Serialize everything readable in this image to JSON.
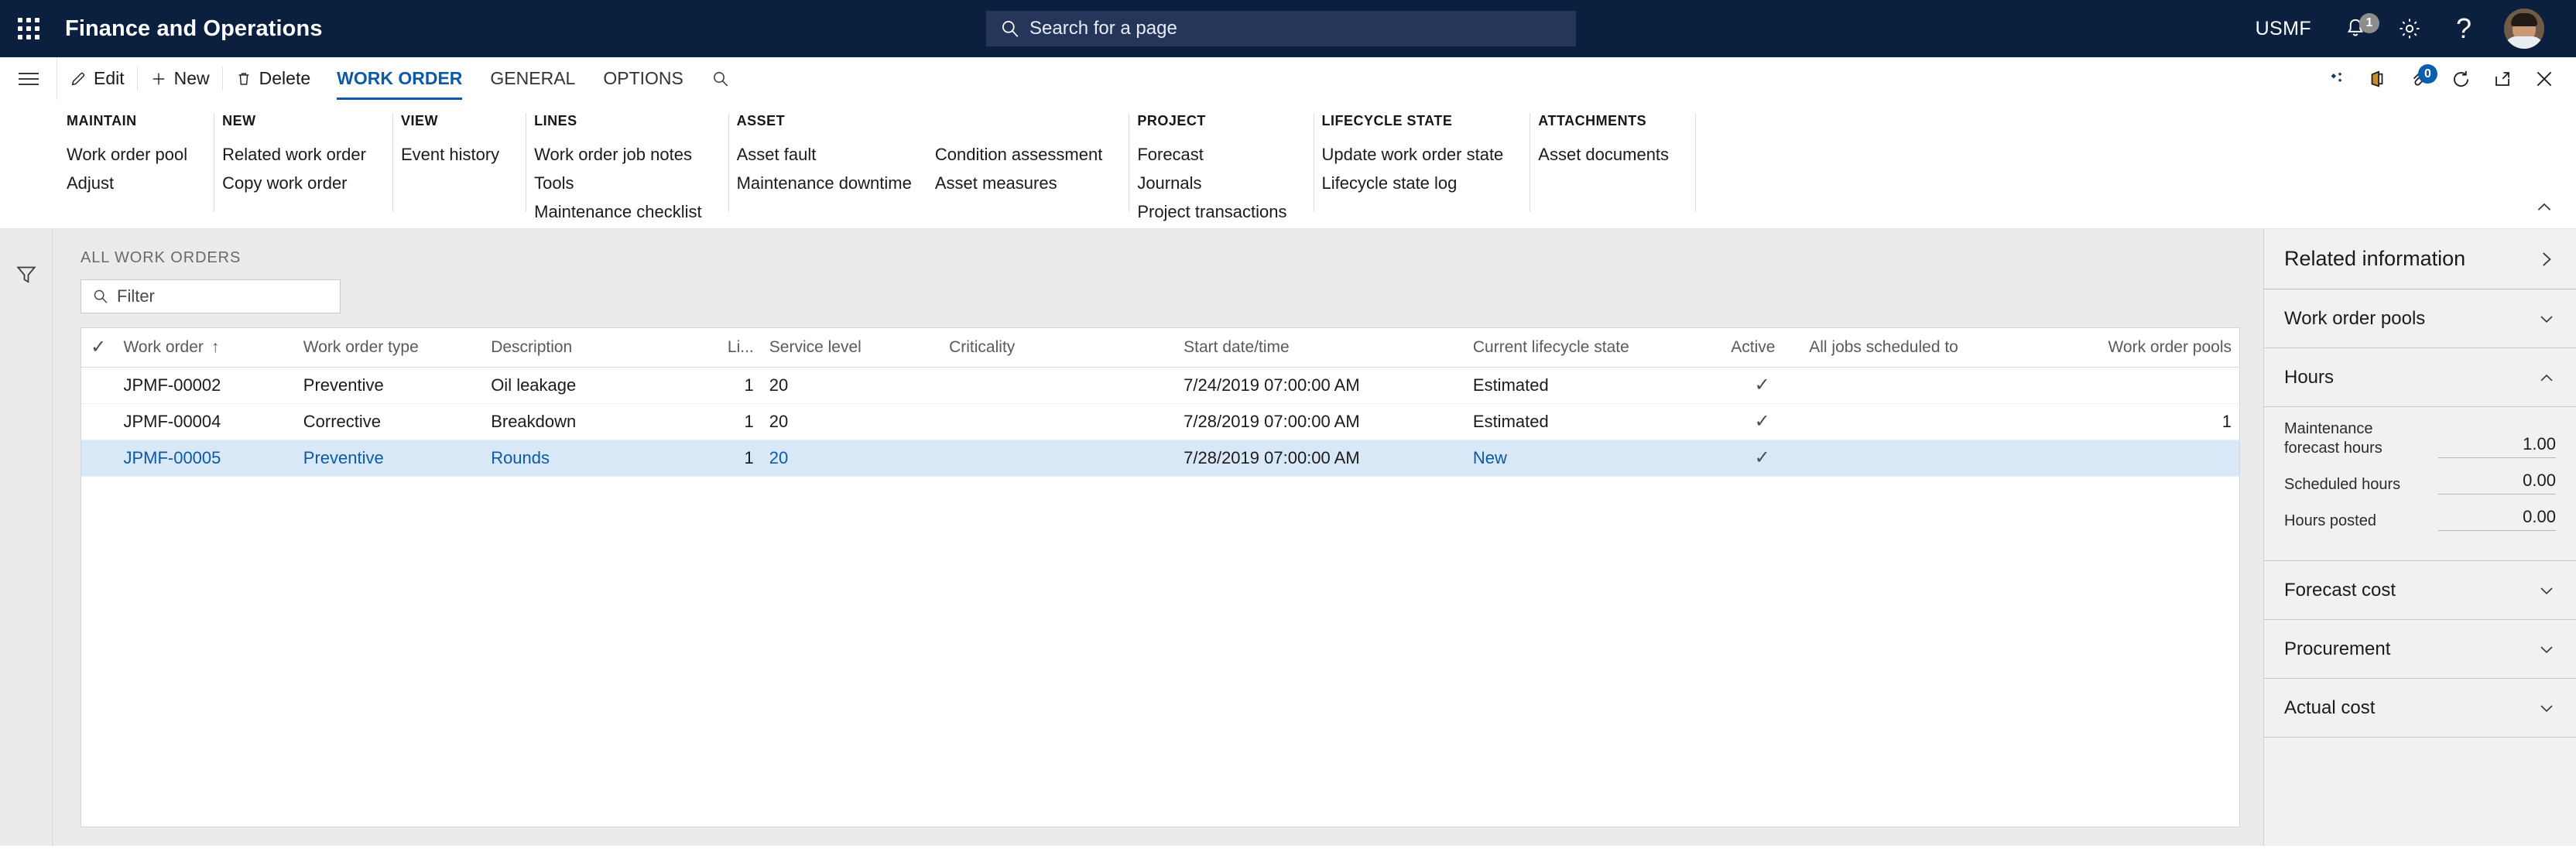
{
  "header": {
    "app_title": "Finance and Operations",
    "waffle_icon": "app-launcher-icon",
    "search_placeholder": "Search for a page",
    "search_icon": "search-icon",
    "company": "USMF",
    "notification_icon": "bell-icon",
    "notification_count": "1",
    "settings_icon": "gear-icon",
    "help_icon": "question-mark-icon",
    "avatar_icon": "user-avatar"
  },
  "action_pane": {
    "menu_icon": "hamburger-icon",
    "buttons": [
      {
        "label": "Edit",
        "icon": "pencil-icon"
      },
      {
        "label": "New",
        "icon": "plus-icon"
      },
      {
        "label": "Delete",
        "icon": "trash-icon"
      }
    ],
    "tabs": [
      {
        "label": "WORK ORDER",
        "active": true
      },
      {
        "label": "GENERAL",
        "active": false
      },
      {
        "label": "OPTIONS",
        "active": false
      }
    ],
    "tab_search_icon": "search-icon",
    "right_icons": [
      {
        "name": "personalize-icon"
      },
      {
        "name": "office-icon"
      },
      {
        "name": "attachment-icon",
        "badge": "0"
      },
      {
        "name": "refresh-icon"
      },
      {
        "name": "open-in-new-window-icon"
      },
      {
        "name": "close-icon"
      }
    ],
    "collapse_icon": "chevron-up-icon"
  },
  "ribbon": {
    "groups": [
      {
        "title": "MAINTAIN",
        "columns": [
          [
            "Work order pool",
            "Adjust"
          ]
        ]
      },
      {
        "title": "NEW",
        "columns": [
          [
            "Related work order",
            "Copy work order"
          ]
        ]
      },
      {
        "title": "VIEW",
        "columns": [
          [
            "Event history"
          ]
        ]
      },
      {
        "title": "LINES",
        "columns": [
          [
            "Work order job notes",
            "Tools",
            "Maintenance checklist"
          ]
        ]
      },
      {
        "title": "ASSET",
        "columns": [
          [
            "Asset fault",
            "Maintenance downtime"
          ],
          [
            "Condition assessment",
            "Asset measures"
          ]
        ]
      },
      {
        "title": "PROJECT",
        "columns": [
          [
            "Forecast",
            "Journals",
            "Project transactions"
          ]
        ]
      },
      {
        "title": "LIFECYCLE STATE",
        "columns": [
          [
            "Update work order state",
            "Lifecycle state log"
          ]
        ]
      },
      {
        "title": "ATTACHMENTS",
        "columns": [
          [
            "Asset documents"
          ]
        ]
      }
    ]
  },
  "left_rail": {
    "filter_icon": "funnel-icon"
  },
  "grid": {
    "caption": "ALL WORK ORDERS",
    "filter_placeholder": "Filter",
    "filter_icon": "search-icon",
    "select_all_icon": "checkmark-icon",
    "sort_indicator": "↑",
    "columns": [
      "Work order",
      "Work order type",
      "Description",
      "Li...",
      "Service level",
      "Criticality",
      "Start date/time",
      "Current lifecycle state",
      "Active",
      "All jobs scheduled to",
      "Work order pools"
    ],
    "sorted_column": "Work order",
    "rows": [
      {
        "work_order": "JPMF-00002",
        "type": "Preventive",
        "description": "Oil leakage",
        "lines": "1",
        "service_level": "20",
        "criticality": "",
        "start_datetime": "7/24/2019 07:00:00 AM",
        "lifecycle_state": "Estimated",
        "active": "✓",
        "all_jobs_scheduled_to": "",
        "work_order_pools": "",
        "selected": false
      },
      {
        "work_order": "JPMF-00004",
        "type": "Corrective",
        "description": "Breakdown",
        "lines": "1",
        "service_level": "20",
        "criticality": "",
        "start_datetime": "7/28/2019 07:00:00 AM",
        "lifecycle_state": "Estimated",
        "active": "✓",
        "all_jobs_scheduled_to": "",
        "work_order_pools": "1",
        "selected": false
      },
      {
        "work_order": "JPMF-00005",
        "type": "Preventive",
        "description": "Rounds",
        "lines": "1",
        "service_level": "20",
        "criticality": "",
        "start_datetime": "7/28/2019 07:00:00 AM",
        "lifecycle_state": "New",
        "active": "✓",
        "all_jobs_scheduled_to": "",
        "work_order_pools": "",
        "selected": true
      }
    ]
  },
  "right_panel": {
    "title": "Related information",
    "title_icon": "chevron-right-icon",
    "sections": [
      {
        "title": "Work order pools",
        "expanded": false,
        "icon": "chevron-down-icon"
      },
      {
        "title": "Hours",
        "expanded": true,
        "icon": "chevron-up-icon"
      },
      {
        "title": "Forecast cost",
        "expanded": false,
        "icon": "chevron-down-icon"
      },
      {
        "title": "Procurement",
        "expanded": false,
        "icon": "chevron-down-icon"
      },
      {
        "title": "Actual cost",
        "expanded": false,
        "icon": "chevron-down-icon"
      }
    ],
    "hours_fields": [
      {
        "label": "Maintenance forecast hours",
        "value": "1.00"
      },
      {
        "label": "Scheduled hours",
        "value": "0.00"
      },
      {
        "label": "Hours posted",
        "value": "0.00"
      }
    ]
  },
  "colors": {
    "nav_bg": "#0b1f3f",
    "accent_blue": "#0c5aa6",
    "selected_row": "#d9e8f7",
    "badge_blue": "#0b5dad",
    "page_bg": "#ebebeb"
  }
}
